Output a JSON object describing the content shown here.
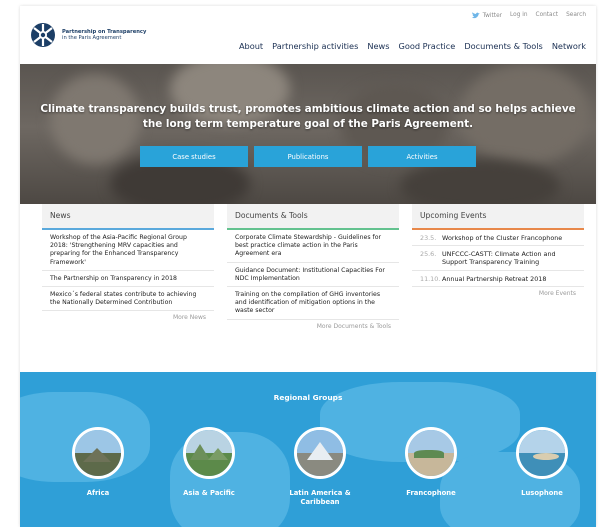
{
  "header": {
    "logo_line1": "Partnership on Transparency",
    "logo_line2": "in the Paris Agreement",
    "top_links": {
      "twitter": "Twitter",
      "login": "Log in",
      "contact": "Contact",
      "search": "Search"
    },
    "nav": [
      "About",
      "Partnership activities",
      "News",
      "Good Practice",
      "Documents & Tools",
      "Network"
    ]
  },
  "hero": {
    "headline": "Climate transparency builds trust, promotes ambitious climate action and so helps achieve the long term temperature goal of the Paris Agreement.",
    "buttons": [
      "Case studies",
      "Publications",
      "Activities"
    ]
  },
  "news": {
    "title": "News",
    "items": [
      "Workshop of the Asia-Pacific Regional Group 2018: 'Strengthening MRV capacities and preparing for the Enhanced Transparency Framework'",
      "The Partnership on Transparency in 2018",
      "Mexico´s federal states contribute to achieving the Nationally Determined Contribution"
    ],
    "more": "More News"
  },
  "documents": {
    "title": "Documents & Tools",
    "items": [
      "Corporate Climate Stewardship - Guidelines for best practice climate action in the Paris Agreement era",
      "Guidance Document: Institutional Capacities For NDC Implementation",
      "Training on the compilation of GHG inventories and identification of mitigation options in the waste sector"
    ],
    "more": "More Documents & Tools"
  },
  "events": {
    "title": "Upcoming Events",
    "items": [
      {
        "date": "23.5.",
        "title": "Workshop of the Cluster Francophone"
      },
      {
        "date": "25.6.",
        "title": "UNFCCC-CASTT: Climate Action and Support Transparency Training"
      },
      {
        "date": "11.10.",
        "title": "Annual Partnership Retreat 2018"
      }
    ],
    "more": "More Events"
  },
  "regional": {
    "title": "Regional Groups",
    "groups": [
      "Africa",
      "Asia & Pacific",
      "Latin America & Caribbean",
      "Francophone",
      "Lusophone"
    ]
  },
  "colors": {
    "accent_blue": "#29a3d9",
    "news_bar": "#5aa9dc",
    "docs_bar": "#63c28f",
    "events_bar": "#e8884a",
    "nav_text": "#1a2f52"
  }
}
